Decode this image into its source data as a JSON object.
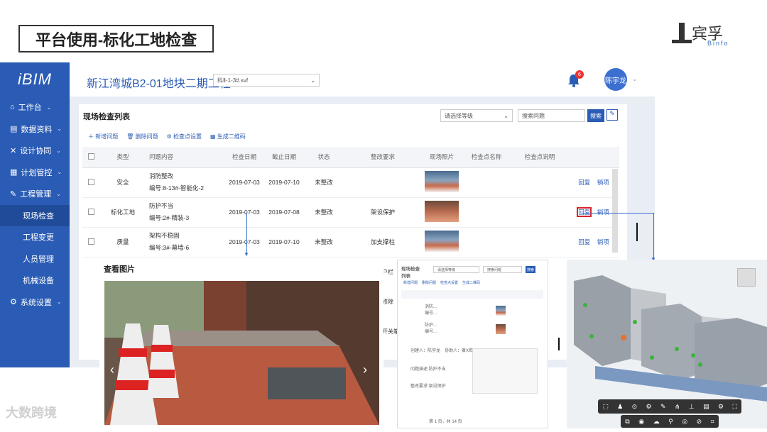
{
  "slide": {
    "title": "平台使用-标化工地检查",
    "brand": {
      "cn": "宾孚",
      "en": "Binfo"
    }
  },
  "app": {
    "logo": "iBIM",
    "project": "新江湾城B2-01地块二期工程",
    "model_select": "科Ⅱ-1-3#.svf",
    "notification_count": "6",
    "user": "陈宇龙",
    "sidebar": [
      {
        "label": "工作台",
        "icon": "home-icon",
        "chevron": "⌄"
      },
      {
        "label": "数据资料",
        "icon": "book-icon",
        "chevron": "⌄"
      },
      {
        "label": "设计协同",
        "icon": "tools-icon",
        "chevron": "⌄"
      },
      {
        "label": "计划管控",
        "icon": "calendar-icon",
        "chevron": "⌄"
      },
      {
        "label": "工程管理",
        "icon": "wrench-icon",
        "chevron": "⌄"
      },
      {
        "label": "现场检查",
        "sub": true,
        "active": true
      },
      {
        "label": "工程变更",
        "sub": true
      },
      {
        "label": "人员管理",
        "sub": true
      },
      {
        "label": "机械设备",
        "sub": true
      },
      {
        "label": "系统设置",
        "icon": "gear-icon",
        "chevron": "⌄"
      }
    ]
  },
  "list": {
    "title": "现场检查列表",
    "grade_placeholder": "请选择等级",
    "search_placeholder": "搜索问题",
    "search_btn": "搜索",
    "toolbar": [
      "新增问题",
      "删除问题",
      "检查点设置",
      "生成二维码"
    ],
    "columns": [
      "类型",
      "问题内容",
      "检查日期",
      "截止日期",
      "状态",
      "整改要求",
      "现场照片",
      "检查点名称",
      "检查点说明"
    ],
    "rows": [
      {
        "type": "安全",
        "title": "消防整改",
        "code": "编号:8-13#-智能化-2",
        "check": "2019-07-03",
        "due": "2019-07-10",
        "status": "未整改",
        "req": "",
        "reply": "回复",
        "close": "销项"
      },
      {
        "type": "标化工地",
        "title": "防护不当",
        "code": "编号:2#-精装-3",
        "check": "2019-07-03",
        "due": "2019-07-08",
        "status": "未整改",
        "req": "架设保护",
        "reply": "回复",
        "close": "销项"
      },
      {
        "type": "质量",
        "title": "架构不稳固",
        "code": "编号:3#-幕墙-6",
        "check": "2019-07-03",
        "due": "2019-07-10",
        "status": "未整改",
        "req": "加支撑柱",
        "reply": "回复",
        "close": "销项"
      }
    ],
    "partial_texts": [
      "户栏",
      "修除",
      "开关箱"
    ]
  },
  "viewer": {
    "title": "查看图片"
  },
  "mini": {
    "title": "现场检查列表",
    "grade": "请选择等级",
    "search": "搜索问题",
    "search_btn": "搜索",
    "toolbar": [
      "新增问题",
      "删除问题",
      "检查点设置",
      "生成二维码"
    ],
    "rows": [
      {
        "a": "消防...",
        "b": "编号..."
      },
      {
        "a": "防护...",
        "b": "编号..."
      }
    ],
    "detail": "创建人：陈宇龙　协助人：黄X若",
    "detail2": "问题描述:防护不当",
    "detail3": "整改要求:架设保护",
    "pagination": "第 1 页，共 14 页"
  },
  "watermark": "大数跨境"
}
